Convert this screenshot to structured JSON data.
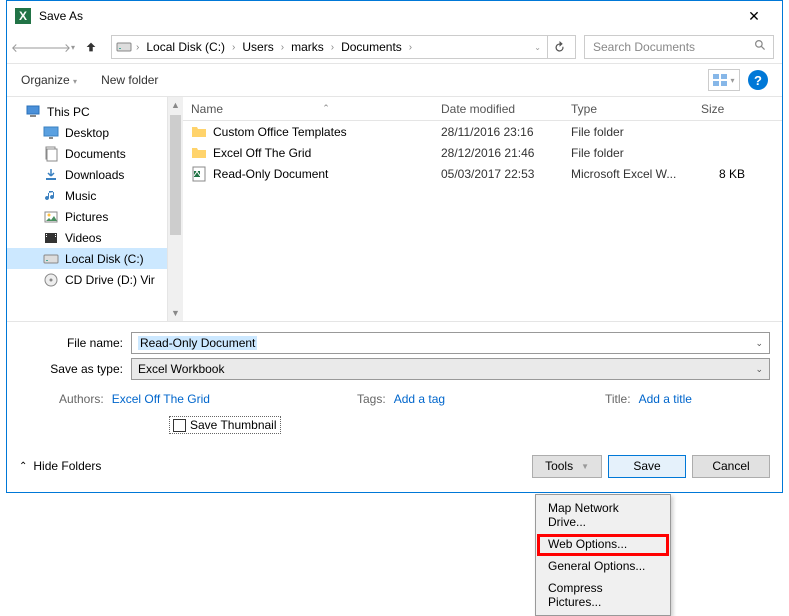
{
  "window": {
    "title": "Save As"
  },
  "breadcrumb": {
    "segments": [
      "Local Disk (C:)",
      "Users",
      "marks",
      "Documents"
    ]
  },
  "search": {
    "placeholder": "Search Documents"
  },
  "toolbar": {
    "organize": "Organize",
    "newfolder": "New folder"
  },
  "sidebar": {
    "items": [
      {
        "label": "This PC",
        "icon": "pc"
      },
      {
        "label": "Desktop",
        "icon": "desktop"
      },
      {
        "label": "Documents",
        "icon": "documents"
      },
      {
        "label": "Downloads",
        "icon": "downloads"
      },
      {
        "label": "Music",
        "icon": "music"
      },
      {
        "label": "Pictures",
        "icon": "pictures"
      },
      {
        "label": "Videos",
        "icon": "videos"
      },
      {
        "label": "Local Disk (C:)",
        "icon": "disk",
        "selected": true
      },
      {
        "label": "CD Drive (D:) Vir",
        "icon": "cd"
      }
    ]
  },
  "columns": {
    "name": "Name",
    "date": "Date modified",
    "type": "Type",
    "size": "Size"
  },
  "files": [
    {
      "name": "Custom Office Templates",
      "date": "28/11/2016 23:16",
      "type": "File folder",
      "size": "",
      "icon": "folder"
    },
    {
      "name": "Excel Off The Grid",
      "date": "28/12/2016 21:46",
      "type": "File folder",
      "size": "",
      "icon": "folder"
    },
    {
      "name": "Read-Only Document",
      "date": "05/03/2017 22:53",
      "type": "Microsoft Excel W...",
      "size": "8 KB",
      "icon": "excel"
    }
  ],
  "form": {
    "filename_label": "File name:",
    "filename_value": "Read-Only Document",
    "savetype_label": "Save as type:",
    "savetype_value": "Excel Workbook",
    "authors_label": "Authors:",
    "authors_value": "Excel Off The Grid",
    "tags_label": "Tags:",
    "tags_value": "Add a tag",
    "title_label": "Title:",
    "title_value": "Add a title",
    "thumbnail_label": "Save Thumbnail"
  },
  "buttons": {
    "hide_folders": "Hide Folders",
    "tools": "Tools",
    "save": "Save",
    "cancel": "Cancel"
  },
  "tools_menu": {
    "items": [
      "Map Network Drive...",
      "Web Options...",
      "General Options...",
      "Compress Pictures..."
    ]
  }
}
